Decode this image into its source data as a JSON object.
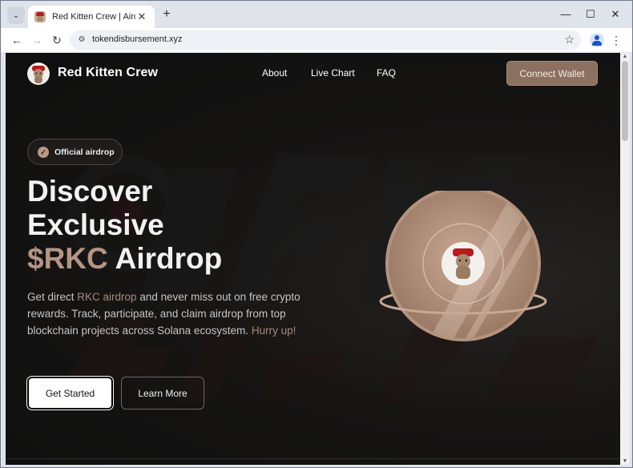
{
  "browser": {
    "tab": {
      "title": "Red Kitten Crew | Airdrop"
    },
    "url": "tokendisbursement.xyz",
    "icons": {
      "tab_search": "chevron-down-icon",
      "tab_close": "close-icon",
      "new_tab": "plus-icon",
      "minimize": "minimize-icon",
      "maximize": "maximize-icon",
      "close": "close-icon",
      "back": "arrow-left-icon",
      "forward": "arrow-right-icon",
      "reload": "reload-icon",
      "site_info": "tune-icon",
      "bookmark": "star-icon",
      "profile": "person-icon",
      "menu": "kebab-menu-icon"
    },
    "glyphs": {
      "tab_search": "⌄",
      "tab_close": "✕",
      "new_tab": "+",
      "minimize": "—",
      "maximize": "☐",
      "close": "✕",
      "back": "←",
      "forward": "→",
      "reload": "↻",
      "site_info": "⚙",
      "bookmark": "☆",
      "menu": "⋮",
      "scroll_up": "▲",
      "scroll_down": "▼"
    }
  },
  "page": {
    "brand": {
      "name": "Red Kitten Crew"
    },
    "nav": {
      "about": "About",
      "live_chart": "Live Chart",
      "faq": "FAQ"
    },
    "connect_wallet": "Connect Wallet",
    "badge": {
      "text": "Official airdrop",
      "icon_glyph": "✓"
    },
    "headline": {
      "line1": "Discover",
      "line2": "Exclusive",
      "ticker": "$RKC",
      "line3_rest": " Airdrop"
    },
    "description": {
      "part1": "Get direct ",
      "highlight1": "RKC airdrop",
      "part2": " and never miss out on free crypto rewards. Track, participate, and claim airdrop from top blockchain projects across Solana ecosystem. ",
      "highlight2": "Hurry up!"
    },
    "buttons": {
      "get_started": "Get Started",
      "learn_more": "Learn More"
    },
    "colors": {
      "accent": "#b49483",
      "button_brown": "#8c7060",
      "background": "#121212",
      "coin_outer": "#c6a58f",
      "coin_inner": "#9e7d67"
    }
  }
}
